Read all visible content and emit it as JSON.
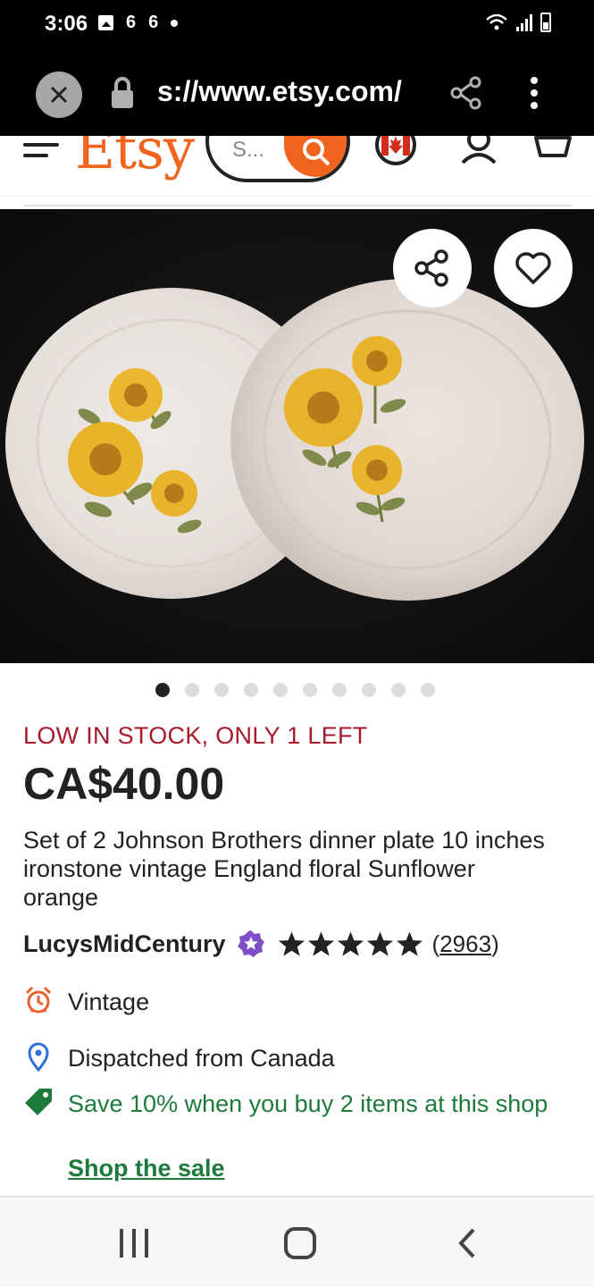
{
  "status_bar": {
    "time": "3:06",
    "left_icons": [
      "gallery-icon",
      "notification-6-icon",
      "notification-6-icon",
      "dot-icon"
    ],
    "left_glyphs": [
      "6",
      "6"
    ],
    "right_icons": [
      "wifi-icon",
      "signal-icon",
      "battery-icon"
    ]
  },
  "browser": {
    "url": "s://www.etsy.com/",
    "icons": [
      "close-icon",
      "lock-icon",
      "share-icon",
      "more-vert-icon"
    ]
  },
  "header": {
    "logo": "Etsy",
    "search_placeholder": "S...",
    "icons": [
      "menu-icon",
      "search-icon",
      "canada-flag-icon",
      "user-icon",
      "cart-icon"
    ]
  },
  "gallery": {
    "image_alt": "Two Johnson Brothers dinner plates with sunflower pattern",
    "dot_count": 10,
    "active_index": 0
  },
  "listing": {
    "stock_notice": "LOW IN STOCK, ONLY 1 LEFT",
    "price": "CA$40.00",
    "title": "Set of 2 Johnson Brothers dinner plate 10 inches ironstone vintage England floral Sunflower orange",
    "shop_name": "LucysMidCentury",
    "rating_stars": 5,
    "review_count": "2963",
    "review_open": "(",
    "review_close": ")"
  },
  "features": {
    "vintage": "Vintage",
    "dispatch": "Dispatched from Canada",
    "sale": "Save 10% when you buy 2 items at this shop",
    "sale_link": "Shop the sale"
  },
  "colors": {
    "etsy_orange": "#f1641e",
    "stock_red": "#a61a2e",
    "sale_green": "#1e7a3c",
    "star_seller_purple": "#7f4fc8",
    "location_blue": "#2f6fd6"
  }
}
